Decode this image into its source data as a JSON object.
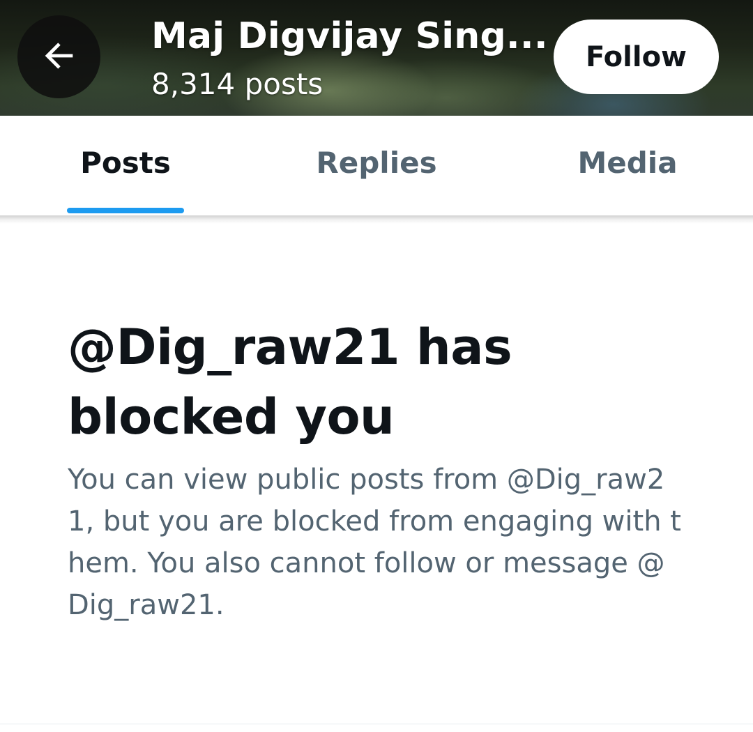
{
  "header": {
    "back_icon": "arrow-left-icon",
    "name": "Maj Digvijay Sing...",
    "post_count": "8,314 posts",
    "follow_label": "Follow"
  },
  "tabs": [
    {
      "label": "Posts",
      "active": true
    },
    {
      "label": "Replies",
      "active": false
    },
    {
      "label": "Media",
      "active": false
    }
  ],
  "colors": {
    "accent": "#1d9bf0",
    "primary_text": "#0f1419",
    "secondary_text": "#536471"
  },
  "blocked_notice": {
    "title": "@Dig_raw21 has blocked you",
    "message": "You can view public posts from @Dig_raw21, but you are blocked from engaging with them. You also cannot follow or message @Dig_raw21."
  }
}
